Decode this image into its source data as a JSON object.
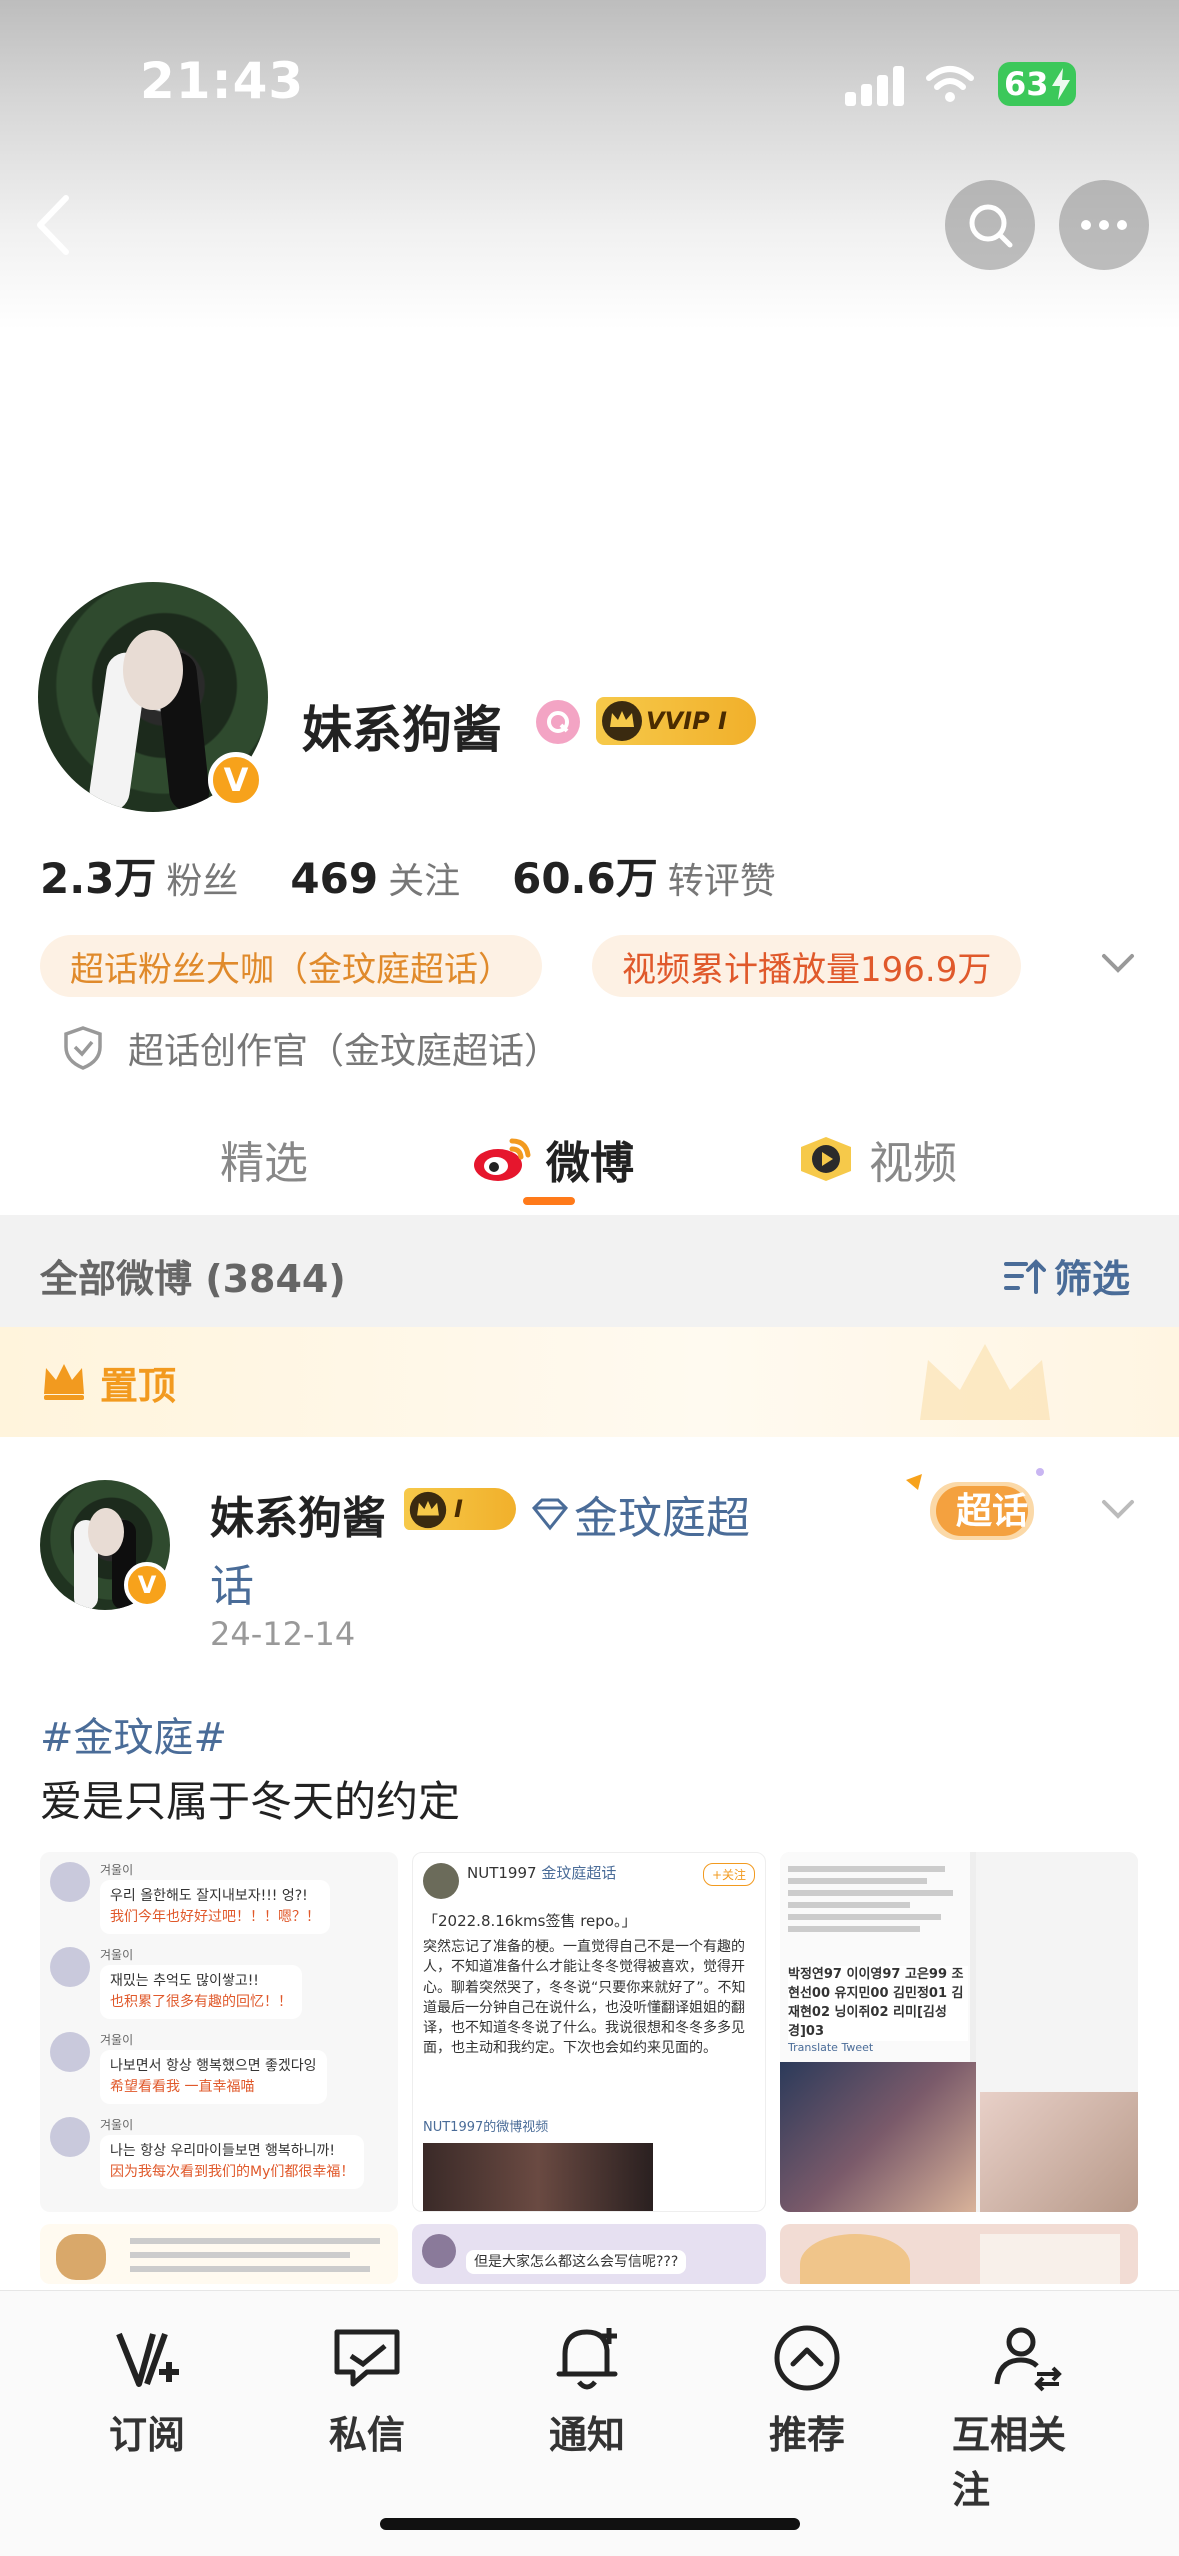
{
  "status_bar": {
    "time": "21:43",
    "battery": "63"
  },
  "profile": {
    "name": "妹系狗酱",
    "vip_badge": "VVIP",
    "vip_level": "I",
    "stats": [
      {
        "value": "2.3万",
        "label": "粉丝"
      },
      {
        "value": "469",
        "label": "关注"
      },
      {
        "value": "60.6万",
        "label": "转评赞"
      }
    ],
    "chips": [
      "超话粉丝大咖（金玟庭超话）",
      "视频累计播放量196.9万"
    ],
    "creator": "超话创作官（金玟庭超话）"
  },
  "tabs": [
    {
      "label": "精选"
    },
    {
      "label": "微博"
    },
    {
      "label": "视频"
    }
  ],
  "filter": {
    "count_label": "全部微博 (3844)",
    "filter_label": "筛选"
  },
  "pinned": {
    "label": "置顶"
  },
  "post": {
    "author": "妹系狗酱",
    "level": "I",
    "topic_part1": "金玟庭超",
    "topic_part2": "话",
    "date": "24-12-14",
    "chaohua_label": "超话",
    "hashtag": "#金玟庭#",
    "text": "爱是只属于冬天的约定",
    "thumb1": {
      "rows": [
        {
          "name": "겨울이",
          "ko": "우리 올한해도 잘지내보자!!! 엉?!",
          "cn": "我们今年也好好过吧！！！嗯？！"
        },
        {
          "name": "겨울이",
          "ko": "재밌는 추억도 많이쌓고!!",
          "cn": "也积累了很多有趣的回忆！！"
        },
        {
          "name": "겨울이",
          "ko": "나보면서 항상 행복했으면 좋겠다잉",
          "cn": "希望看看我 一直幸福喵"
        },
        {
          "name": "겨울이",
          "ko": "나는 항상 우리마이들보면 행복하니까!",
          "cn": "因为我每次看到我们的My们都很幸福！"
        }
      ]
    },
    "thumb2": {
      "header": "NUT1997",
      "topic": "金玟庭超话",
      "follow": "+关注",
      "quote": "「2022.8.16kms签售 repo。」",
      "body": "突然忘记了准备的梗。一直觉得自己不是一个有趣的人，不知道准备什么才能让冬冬觉得被喜欢，觉得开心。聊着突然哭了，冬冬说“只要你来就好了”。不知道最后一分钟自己在说什么，也没听懂翻译姐姐的翻译，也不知道冬冬说了什么。我说很想和冬冬多多见面，也主动和我约定。下次也会如约来见面的。",
      "link": "NUT1997的微博视频"
    },
    "thumb3": {
      "names": "박정연97 이이영97 고은99 조현선00 유지민00 김민정01 김재현02 닝이쥐02 리미[김성경]03",
      "link": "Translate Tweet"
    },
    "thumb5": {
      "question": "但是大家怎么都这么会写信呢???"
    }
  },
  "bottom_nav": [
    {
      "label": "订阅",
      "icon": "subscribe-icon"
    },
    {
      "label": "私信",
      "icon": "message-icon"
    },
    {
      "label": "通知",
      "icon": "bell-icon"
    },
    {
      "label": "推荐",
      "icon": "recommend-icon"
    },
    {
      "label": "互相关注",
      "icon": "mutual-follow-icon"
    }
  ],
  "colors": {
    "accent_orange": "#ff7a1a",
    "link_blue": "#4a6c98",
    "gold": "#f29a1f"
  }
}
